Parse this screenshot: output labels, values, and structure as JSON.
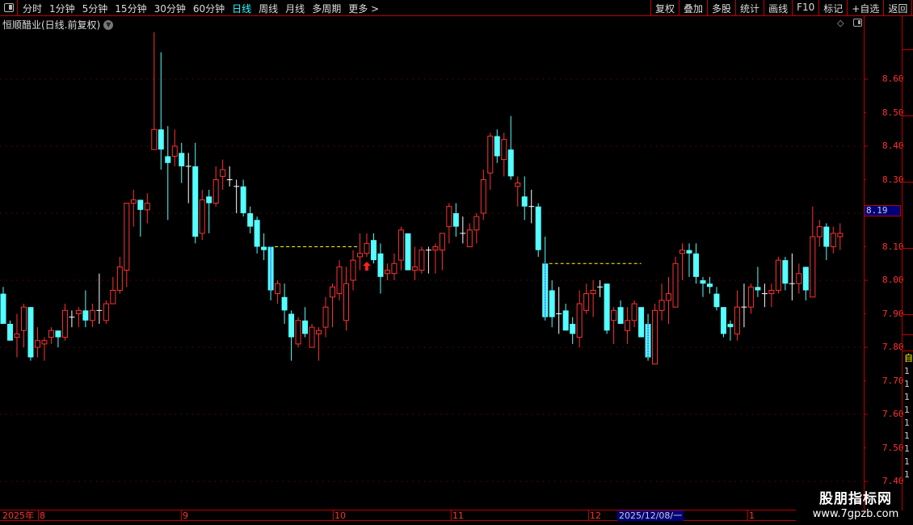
{
  "toolbar": {
    "periods": [
      "分时",
      "1分钟",
      "5分钟",
      "15分钟",
      "30分钟",
      "60分钟",
      "日线",
      "周线",
      "月线",
      "多周期",
      "更多 >"
    ],
    "active_period": "日线",
    "buttons": [
      "复权",
      "叠加",
      "多股",
      "统计",
      "画线",
      "F10",
      "标记",
      "+自选",
      "返回"
    ]
  },
  "chart_title": "恒顺醋业(日线.前复权)",
  "price_axis": {
    "labels": [
      "8.60",
      "8.50",
      "8.40",
      "8.30",
      "8.10",
      "8.00",
      "7.90",
      "7.80",
      "7.70",
      "7.60",
      "7.50",
      "7.40"
    ],
    "current_price": "8.19"
  },
  "date_axis": {
    "labels": [
      "2025年",
      "8",
      "9",
      "10",
      "11",
      "12",
      "1"
    ],
    "selected": "2025/12/08/一"
  },
  "side_panel": {
    "labels": [
      "自",
      "1",
      "1",
      "1",
      "1",
      "1",
      "1",
      "1",
      "1",
      "1"
    ]
  },
  "watermark": {
    "line1": "股朋指标网",
    "line2": "www.7gpzb.com"
  },
  "colors": {
    "up": "#ff3232",
    "down": "#54ffff",
    "doji": "#ffffff",
    "grid": "#8b0000",
    "dashed": "#ffff00",
    "active_period": "#33ffff",
    "selected_bg": "#00007a"
  },
  "chart_data": {
    "type": "candlestick",
    "ylim": [
      7.4,
      8.75
    ],
    "grid_levels": [
      8.6,
      8.4,
      8.2,
      8.0,
      7.8,
      7.6,
      7.4
    ],
    "ohlc_format": [
      "open",
      "close",
      "high",
      "low"
    ],
    "candles": [
      [
        7.96,
        7.87,
        7.98,
        7.87
      ],
      [
        7.87,
        7.82,
        7.88,
        7.82
      ],
      [
        7.83,
        7.84,
        7.9,
        7.77
      ],
      [
        7.85,
        7.92,
        7.93,
        7.8
      ],
      [
        7.92,
        7.77,
        7.92,
        7.76
      ],
      [
        7.8,
        7.82,
        7.86,
        7.77
      ],
      [
        7.81,
        7.82,
        7.83,
        7.76
      ],
      [
        7.83,
        7.85,
        7.86,
        7.81
      ],
      [
        7.85,
        7.83,
        7.85,
        7.8
      ],
      [
        7.83,
        7.91,
        7.93,
        7.82
      ],
      [
        7.89,
        7.89,
        7.91,
        7.86
      ],
      [
        7.9,
        7.91,
        7.92,
        7.86
      ],
      [
        7.91,
        7.88,
        7.97,
        7.86
      ],
      [
        7.88,
        7.91,
        7.93,
        7.86
      ],
      [
        7.91,
        7.91,
        8.02,
        7.87
      ],
      [
        7.88,
        7.93,
        7.94,
        7.87
      ],
      [
        7.93,
        7.97,
        8.01,
        7.93
      ],
      [
        7.97,
        8.04,
        8.07,
        7.96
      ],
      [
        8.03,
        8.23,
        8.23,
        7.98
      ],
      [
        8.23,
        8.24,
        8.27,
        8.16
      ],
      [
        8.24,
        8.21,
        8.24,
        8.13
      ],
      [
        8.21,
        8.23,
        8.26,
        8.17
      ],
      [
        8.39,
        8.45,
        8.74,
        8.39
      ],
      [
        8.45,
        8.39,
        8.68,
        8.33
      ],
      [
        8.37,
        8.35,
        8.46,
        8.18
      ],
      [
        8.37,
        8.4,
        8.45,
        8.34
      ],
      [
        8.38,
        8.34,
        8.41,
        8.29
      ],
      [
        8.34,
        8.34,
        8.38,
        8.23
      ],
      [
        8.34,
        8.13,
        8.41,
        8.11
      ],
      [
        8.14,
        8.24,
        8.27,
        8.12
      ],
      [
        8.25,
        8.23,
        8.27,
        8.14
      ],
      [
        8.23,
        8.3,
        8.34,
        8.22
      ],
      [
        8.31,
        8.33,
        8.36,
        8.27
      ],
      [
        8.3,
        8.3,
        8.34,
        8.28
      ],
      [
        8.28,
        8.28,
        8.3,
        8.2
      ],
      [
        8.28,
        8.2,
        8.3,
        8.19
      ],
      [
        8.2,
        8.16,
        8.22,
        8.14
      ],
      [
        8.18,
        8.1,
        8.19,
        8.08
      ],
      [
        8.1,
        8.09,
        8.14,
        8.06
      ],
      [
        8.1,
        7.97,
        8.1,
        7.94
      ],
      [
        7.96,
        7.99,
        8.0,
        7.93
      ],
      [
        7.95,
        7.91,
        7.99,
        7.87
      ],
      [
        7.9,
        7.83,
        7.91,
        7.76
      ],
      [
        7.81,
        7.88,
        7.89,
        7.8
      ],
      [
        7.88,
        7.84,
        7.92,
        7.83
      ],
      [
        7.8,
        7.86,
        7.87,
        7.8
      ],
      [
        7.84,
        7.85,
        7.86,
        7.76
      ],
      [
        7.86,
        7.92,
        7.95,
        7.83
      ],
      [
        7.95,
        7.98,
        7.99,
        7.86
      ],
      [
        7.96,
        8.04,
        8.06,
        7.94
      ],
      [
        7.88,
        7.99,
        8.04,
        7.85
      ],
      [
        8.0,
        8.06,
        8.09,
        7.97
      ],
      [
        8.07,
        8.08,
        8.14,
        8.03
      ],
      [
        8.08,
        8.11,
        8.14,
        8.07
      ],
      [
        8.12,
        8.06,
        8.14,
        8.05
      ],
      [
        8.08,
        8.01,
        8.11,
        7.96
      ],
      [
        8.02,
        8.03,
        8.05,
        8.0
      ],
      [
        8.02,
        8.05,
        8.08,
        8.0
      ],
      [
        8.06,
        8.15,
        8.16,
        8.03
      ],
      [
        8.14,
        8.03,
        8.14,
        8.03
      ],
      [
        8.03,
        8.04,
        8.1,
        8.0
      ],
      [
        8.03,
        8.09,
        8.1,
        8.02
      ],
      [
        8.09,
        8.09,
        8.1,
        8.02
      ],
      [
        8.09,
        8.1,
        8.11,
        8.02
      ],
      [
        8.09,
        8.14,
        8.14,
        8.03
      ],
      [
        8.16,
        8.22,
        8.23,
        8.11
      ],
      [
        8.2,
        8.16,
        8.23,
        8.13
      ],
      [
        8.14,
        8.14,
        8.19,
        8.11
      ],
      [
        8.1,
        8.15,
        8.17,
        8.1
      ],
      [
        8.15,
        8.19,
        8.2,
        8.11
      ],
      [
        8.2,
        8.3,
        8.33,
        8.18
      ],
      [
        8.32,
        8.43,
        8.44,
        8.27
      ],
      [
        8.43,
        8.37,
        8.45,
        8.35
      ],
      [
        8.36,
        8.42,
        8.44,
        8.31
      ],
      [
        8.39,
        8.31,
        8.49,
        8.3
      ],
      [
        8.28,
        8.29,
        8.31,
        8.22
      ],
      [
        8.25,
        8.22,
        8.31,
        8.18
      ],
      [
        8.22,
        8.22,
        8.27,
        8.17
      ],
      [
        8.22,
        8.09,
        8.23,
        8.07
      ],
      [
        8.05,
        7.89,
        8.13,
        7.88
      ],
      [
        7.97,
        7.89,
        8.0,
        7.86
      ],
      [
        7.9,
        7.9,
        7.98,
        7.84
      ],
      [
        7.91,
        7.85,
        7.93,
        7.85
      ],
      [
        7.87,
        7.84,
        7.89,
        7.81
      ],
      [
        7.83,
        7.93,
        7.97,
        7.8
      ],
      [
        7.91,
        7.96,
        7.99,
        7.9
      ],
      [
        7.96,
        7.97,
        8.0,
        7.89
      ],
      [
        7.98,
        7.98,
        8.0,
        7.95
      ],
      [
        7.99,
        7.85,
        7.99,
        7.84
      ],
      [
        7.88,
        7.91,
        7.92,
        7.81
      ],
      [
        7.92,
        7.87,
        7.94,
        7.87
      ],
      [
        7.85,
        7.88,
        7.92,
        7.81
      ],
      [
        7.88,
        7.93,
        7.94,
        7.86
      ],
      [
        7.92,
        7.83,
        7.92,
        7.83
      ],
      [
        7.87,
        7.77,
        7.9,
        7.76
      ],
      [
        7.75,
        7.91,
        7.93,
        7.75
      ],
      [
        7.91,
        7.94,
        7.99,
        7.88
      ],
      [
        7.94,
        7.96,
        8.01,
        7.87
      ],
      [
        7.92,
        8.05,
        8.07,
        7.92
      ],
      [
        8.08,
        8.09,
        8.11,
        8.0
      ],
      [
        8.09,
        8.08,
        8.11,
        8.01
      ],
      [
        8.08,
        8.01,
        8.11,
        7.99
      ],
      [
        8.0,
        7.99,
        8.01,
        7.95
      ],
      [
        7.99,
        7.98,
        8.01,
        7.96
      ],
      [
        7.96,
        7.92,
        7.98,
        7.91
      ],
      [
        7.92,
        7.84,
        7.92,
        7.83
      ],
      [
        7.87,
        7.86,
        7.88,
        7.82
      ],
      [
        7.84,
        7.92,
        7.97,
        7.82
      ],
      [
        7.92,
        7.92,
        7.99,
        7.86
      ],
      [
        7.92,
        7.98,
        7.99,
        7.9
      ],
      [
        7.98,
        7.97,
        8.04,
        7.95
      ],
      [
        7.96,
        7.96,
        7.99,
        7.92
      ],
      [
        7.96,
        7.97,
        7.99,
        7.92
      ],
      [
        7.97,
        8.06,
        8.07,
        7.96
      ],
      [
        8.06,
        7.99,
        8.07,
        7.97
      ],
      [
        7.99,
        7.99,
        8.08,
        7.94
      ],
      [
        7.99,
        8.02,
        8.05,
        7.96
      ],
      [
        8.04,
        7.97,
        8.04,
        7.94
      ],
      [
        7.95,
        8.13,
        8.22,
        7.95
      ],
      [
        8.13,
        8.16,
        8.18,
        8.1
      ],
      [
        8.16,
        8.1,
        8.17,
        8.06
      ],
      [
        8.1,
        8.14,
        8.16,
        8.08
      ],
      [
        8.13,
        8.14,
        8.17,
        8.09
      ]
    ],
    "marked_candles": [
      40,
      80,
      95
    ],
    "dashed_levels": [
      {
        "price": 8.1,
        "from_candle": 40,
        "to_candle": 53
      },
      {
        "price": 8.05,
        "from_candle": 80,
        "to_candle": 94
      }
    ],
    "signal_arrows": [
      {
        "candle": 54,
        "direction": "up"
      }
    ]
  }
}
